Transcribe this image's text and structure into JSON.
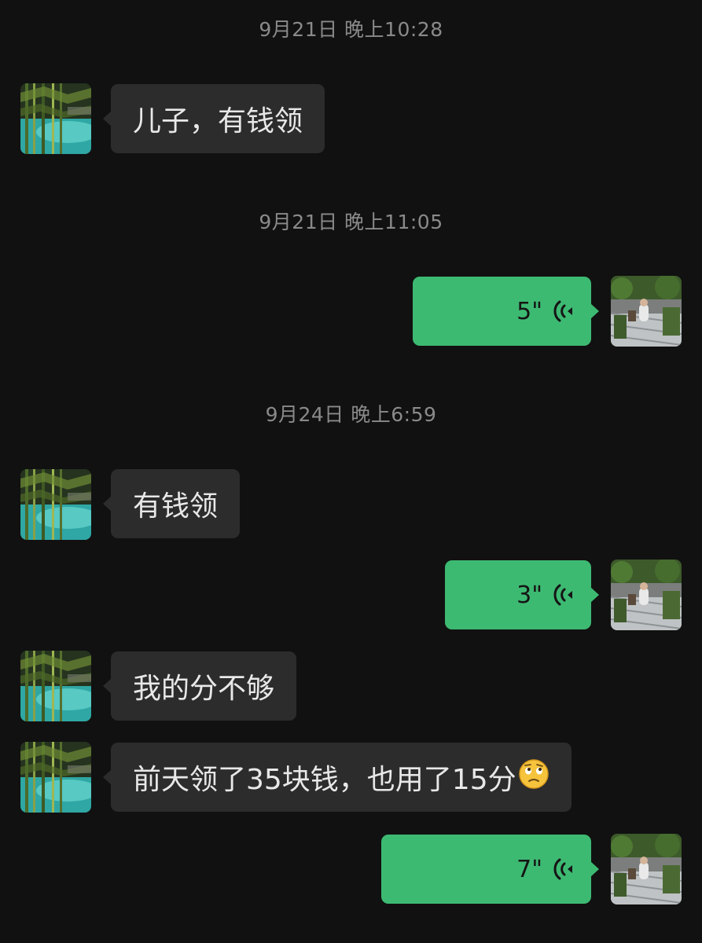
{
  "colors": {
    "background": "#111111",
    "incoming_bubble": "#2c2c2c",
    "outgoing_bubble": "#3dba72",
    "timestamp_text": "#8a8a8a"
  },
  "messages": [
    {
      "type": "timestamp",
      "text": "9月21日 晚上10:28"
    },
    {
      "type": "text",
      "direction": "incoming",
      "text": "儿子，有钱领"
    },
    {
      "type": "timestamp",
      "text": "9月21日 晚上11:05"
    },
    {
      "type": "voice",
      "direction": "outgoing",
      "duration": "5\"",
      "icon": "voice-wave-icon"
    },
    {
      "type": "timestamp",
      "text": "9月24日 晚上6:59"
    },
    {
      "type": "text",
      "direction": "incoming",
      "text": "有钱领"
    },
    {
      "type": "voice",
      "direction": "outgoing",
      "duration": "3\"",
      "icon": "voice-wave-icon"
    },
    {
      "type": "text",
      "direction": "incoming",
      "text": "我的分不够"
    },
    {
      "type": "text",
      "direction": "incoming",
      "text": "前天领了35块钱，也用了15分",
      "emoji": "thinking-face-emoji"
    },
    {
      "type": "voice",
      "direction": "outgoing",
      "duration": "7\"",
      "icon": "voice-wave-icon"
    }
  ]
}
